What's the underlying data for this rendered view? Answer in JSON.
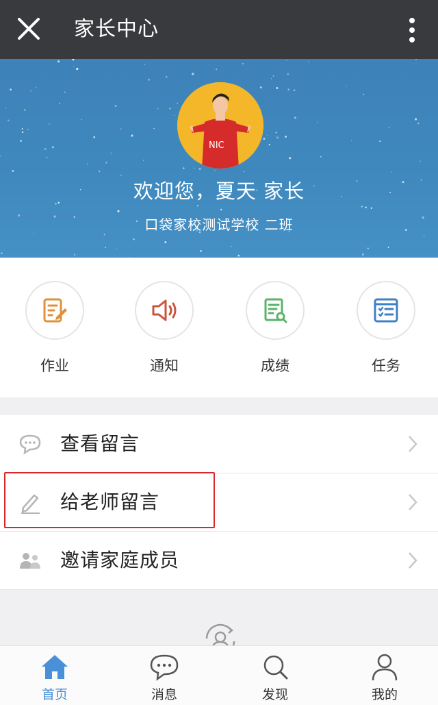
{
  "header": {
    "title": "家长中心",
    "close_icon": "close-icon",
    "more_icon": "more-vertical-icon",
    "bg_color": "#393a3e"
  },
  "profile": {
    "welcome": "欢迎您，夏天 家长",
    "school": "口袋家校测试学校  二班",
    "avatar_text": "NIC",
    "banner_color": "#3f89be"
  },
  "quick_actions": [
    {
      "label": "作业",
      "icon": "homework-icon",
      "color": "#e0903a"
    },
    {
      "label": "通知",
      "icon": "speaker-icon",
      "color": "#c9553a"
    },
    {
      "label": "成绩",
      "icon": "grades-icon",
      "color": "#5bb36a"
    },
    {
      "label": "任务",
      "icon": "tasks-icon",
      "color": "#3f7fc4"
    }
  ],
  "menu": [
    {
      "label": "查看留言",
      "icon": "chat-bubble-icon"
    },
    {
      "label": "给老师留言",
      "icon": "pencil-icon",
      "highlighted": true
    },
    {
      "label": "邀请家庭成员",
      "icon": "family-icon"
    }
  ],
  "tabs": [
    {
      "label": "首页",
      "icon": "home-icon",
      "active": true
    },
    {
      "label": "消息",
      "icon": "message-icon",
      "active": false
    },
    {
      "label": "发现",
      "icon": "discover-icon",
      "active": false
    },
    {
      "label": "我的",
      "icon": "profile-icon",
      "active": false
    }
  ],
  "colors": {
    "accent": "#4a90d9",
    "highlight_border": "#d8262d"
  }
}
